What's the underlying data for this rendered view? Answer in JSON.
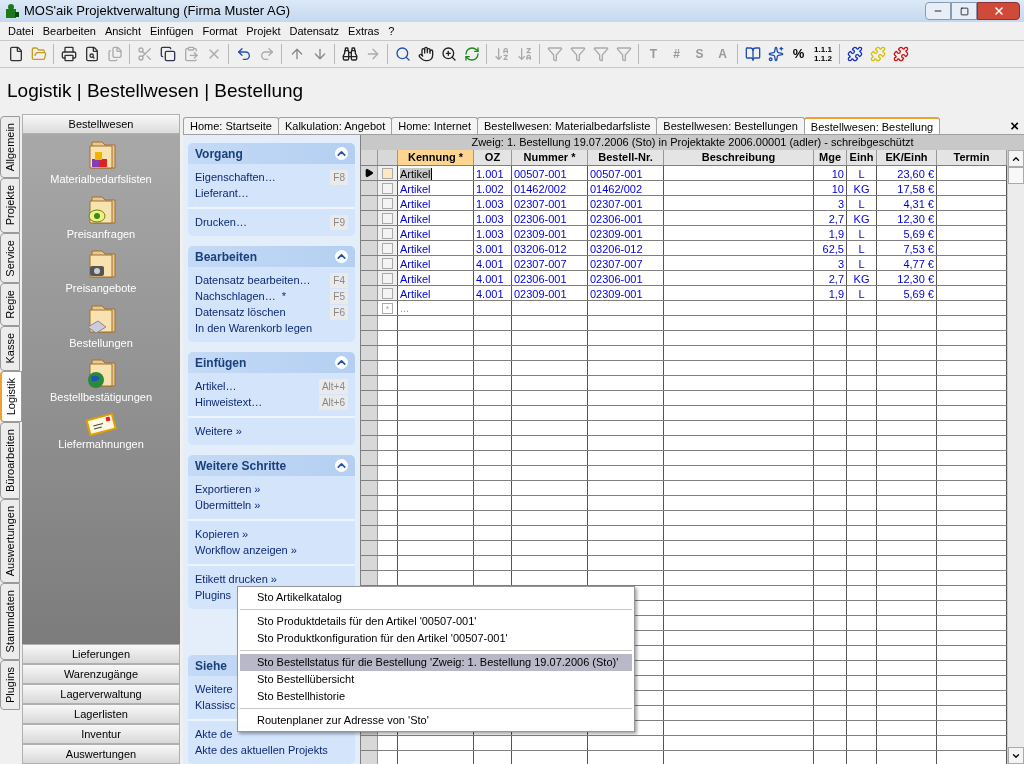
{
  "window": {
    "title": "MOS'aik Projektverwaltung (Firma Muster AG)"
  },
  "menu": [
    "Datei",
    "Bearbeiten",
    "Ansicht",
    "Einfügen",
    "Format",
    "Projekt",
    "Datensatz",
    "Extras",
    "?"
  ],
  "toolbar": {
    "glyph_buttons": [
      "T",
      "#",
      "S",
      "A"
    ],
    "percent": "%",
    "numbering": [
      "1.1.1",
      "1.1.2"
    ]
  },
  "breadcrumb": "Logistik | Bestellwesen | Bestellung",
  "vertical_tabs": [
    {
      "label": "Allgemein",
      "selected": false
    },
    {
      "label": "Projekte",
      "selected": false
    },
    {
      "label": "Service",
      "selected": false
    },
    {
      "label": "Regie",
      "selected": false
    },
    {
      "label": "Kasse",
      "selected": false
    },
    {
      "label": "Logistik",
      "selected": true
    },
    {
      "label": "Büroarbeiten",
      "selected": false
    },
    {
      "label": "Auswertungen",
      "selected": false
    },
    {
      "label": "Stammdaten",
      "selected": false
    },
    {
      "label": "Plugins",
      "selected": false
    }
  ],
  "sidebar": {
    "header": "Bestellwesen",
    "items": [
      {
        "label": "Materialbedarfslisten",
        "kind": "blocks"
      },
      {
        "label": "Preisanfragen",
        "kind": "question"
      },
      {
        "label": "Preisangebote",
        "kind": "phone"
      },
      {
        "label": "Bestellungen",
        "kind": "paper"
      },
      {
        "label": "Bestellbestätigungen",
        "kind": "globe"
      },
      {
        "label": "Liefermahnungen",
        "kind": "letter"
      }
    ],
    "sections": [
      "Lieferungen",
      "Warenzugänge",
      "Lagerverwaltung",
      "Lagerlisten",
      "Inventur",
      "Auswertungen"
    ]
  },
  "tabs": [
    {
      "label": "Home: Startseite",
      "selected": false
    },
    {
      "label": "Kalkulation: Angebot",
      "selected": false
    },
    {
      "label": "Home: Internet",
      "selected": false
    },
    {
      "label": "Bestellwesen: Materialbedarfsliste",
      "selected": false
    },
    {
      "label": "Bestellwesen: Bestellungen",
      "selected": false
    },
    {
      "label": "Bestellwesen: Bestellung",
      "selected": true
    }
  ],
  "close_tab": "×",
  "task_pane": [
    {
      "title": "Vorgang",
      "sections": [
        [
          {
            "label": "Eigenschaften…",
            "shortcut": "F8"
          },
          {
            "label": "Lieferant…"
          }
        ],
        [
          {
            "label": "Drucken…",
            "shortcut": "F9"
          }
        ]
      ]
    },
    {
      "title": "Bearbeiten",
      "sections": [
        [
          {
            "label": "Datensatz bearbeiten…",
            "shortcut": "F4"
          },
          {
            "label": "Nachschlagen…  *",
            "shortcut": "F5"
          },
          {
            "label": "Datensatz löschen",
            "shortcut": "F6"
          },
          {
            "label": "In den Warenkorb legen"
          }
        ]
      ]
    },
    {
      "title": "Einfügen",
      "sections": [
        [
          {
            "label": "Artikel…",
            "shortcut": "Alt+4"
          },
          {
            "label": "Hinweistext…",
            "shortcut": "Alt+6"
          }
        ],
        [
          {
            "label": "Weitere »"
          }
        ]
      ]
    },
    {
      "title": "Weitere Schritte",
      "sections": [
        [
          {
            "label": "Exportieren »"
          },
          {
            "label": "Übermitteln »"
          }
        ],
        [
          {
            "label": "Kopieren »"
          },
          {
            "label": "Workflow anzeigen »"
          }
        ],
        [
          {
            "label": "Etikett drucken »"
          },
          {
            "label": "Plugins"
          }
        ]
      ]
    },
    {
      "title": "Siehe",
      "sections": [
        [
          {
            "label": "Weitere"
          },
          {
            "label": "Klassisc"
          }
        ],
        [
          {
            "label": "Akte de"
          },
          {
            "label": "Akte des aktuellen Projekts"
          }
        ]
      ]
    }
  ],
  "grid": {
    "caption": "Zweig: 1. Bestellung 19.07.2006 (Sto) in Projektakte 2006.00001 (adler) - schreibgeschützt",
    "columns": [
      "Kennung *",
      "OZ",
      "Nummer *",
      "Bestell-Nr.",
      "Beschreibung",
      "Mge",
      "Einh",
      "EK/Einh",
      "Termin"
    ],
    "rows": [
      {
        "selected": true,
        "cells": [
          "Artikel",
          "1.001",
          "00507-001",
          "00507-001",
          "",
          "10",
          "L",
          "23,60 €",
          ""
        ]
      },
      {
        "selected": false,
        "cells": [
          "Artikel",
          "1.002",
          "01462/002",
          "01462/002",
          "",
          "10",
          "KG",
          "17,58 €",
          ""
        ]
      },
      {
        "selected": false,
        "cells": [
          "Artikel",
          "1.003",
          "02307-001",
          "02307-001",
          "",
          "3",
          "L",
          "4,31 €",
          ""
        ]
      },
      {
        "selected": false,
        "cells": [
          "Artikel",
          "1.003",
          "02306-001",
          "02306-001",
          "",
          "2,7",
          "KG",
          "12,30 €",
          ""
        ]
      },
      {
        "selected": false,
        "cells": [
          "Artikel",
          "1.003",
          "02309-001",
          "02309-001",
          "",
          "1,9",
          "L",
          "5,69 €",
          ""
        ]
      },
      {
        "selected": false,
        "cells": [
          "Artikel",
          "3.001",
          "03206-012",
          "03206-012",
          "",
          "62,5",
          "L",
          "7,53 €",
          ""
        ]
      },
      {
        "selected": false,
        "cells": [
          "Artikel",
          "4.001",
          "02307-007",
          "02307-007",
          "",
          "3",
          "L",
          "4,77 €",
          ""
        ]
      },
      {
        "selected": false,
        "cells": [
          "Artikel",
          "4.001",
          "02306-001",
          "02306-001",
          "",
          "2,7",
          "KG",
          "12,30 €",
          ""
        ]
      },
      {
        "selected": false,
        "cells": [
          "Artikel",
          "4.001",
          "02309-001",
          "02309-001",
          "",
          "1,9",
          "L",
          "5,69 €",
          ""
        ]
      }
    ],
    "new_row": {
      "marker": "*",
      "text": "..."
    }
  },
  "context_menu": {
    "groups": [
      [
        {
          "label": "Sto Artikelkatalog",
          "selected": false
        }
      ],
      [
        {
          "label": "Sto Produktdetails für den Artikel '00507-001'",
          "selected": false
        },
        {
          "label": "Sto Produktkonfiguration für den Artikel '00507-001'",
          "selected": false
        }
      ],
      [
        {
          "label": "Sto Bestellstatus für die Bestellung 'Zweig: 1. Bestellung 19.07.2006 (Sto)'",
          "selected": true
        },
        {
          "label": "Sto Bestellübersicht",
          "selected": false
        },
        {
          "label": "Sto Bestellhistorie",
          "selected": false
        }
      ],
      [
        {
          "label": "Routenplaner zur Adresse von 'Sto'",
          "selected": false
        }
      ]
    ]
  }
}
